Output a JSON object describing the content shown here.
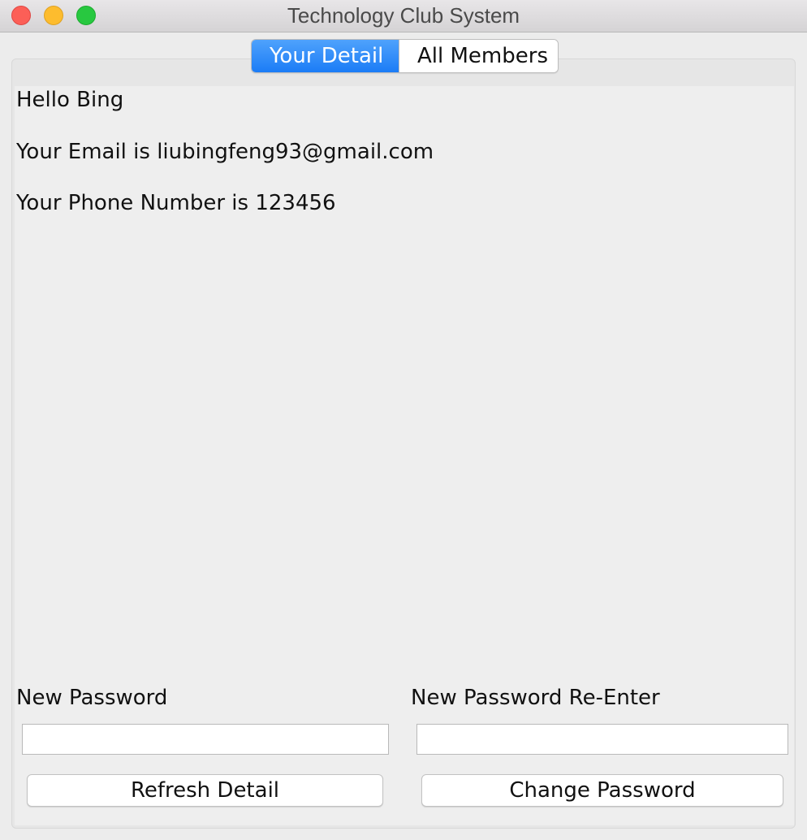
{
  "window": {
    "title": "Technology Club System"
  },
  "tabs": [
    {
      "label": "Your Detail",
      "selected": true
    },
    {
      "label": "All Members",
      "selected": false
    }
  ],
  "detail": {
    "greeting": "Hello Bing",
    "email_line": "Your Email is liubingfeng93@gmail.com",
    "phone_line": "Your Phone Number is 123456"
  },
  "password_form": {
    "new_password_label": "New Password",
    "new_password_value": "",
    "reenter_label": "New Password Re-Enter",
    "reenter_value": ""
  },
  "buttons": {
    "refresh_label": "Refresh Detail",
    "change_password_label": "Change Password"
  },
  "colors": {
    "accent": "#1b7cf6",
    "close": "#fc5f57",
    "minimize": "#fdbc2e",
    "zoom": "#28c840"
  }
}
